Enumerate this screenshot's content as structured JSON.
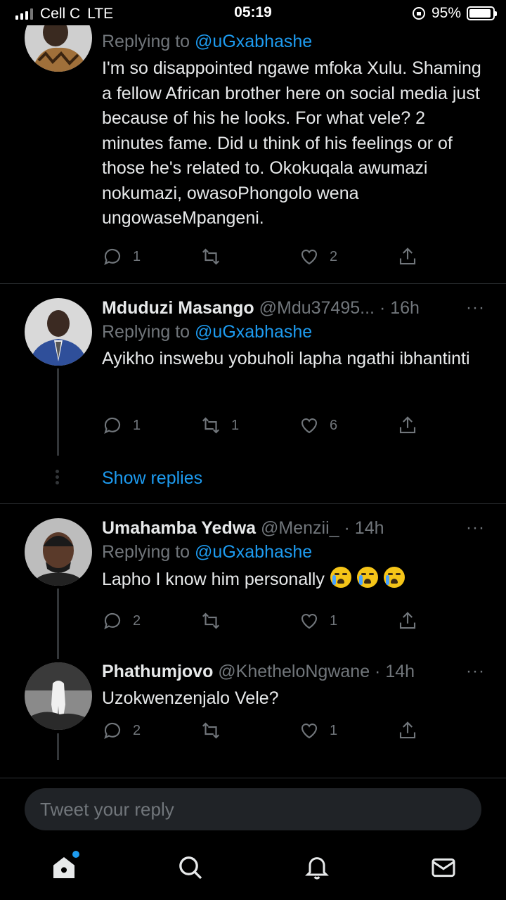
{
  "status_bar": {
    "carrier": "Cell C",
    "network": "LTE",
    "time": "05:19",
    "battery_percent": "95%",
    "battery_level": 0.95
  },
  "replies": [
    {
      "reply_prefix": "Replying to",
      "reply_mention": "@uGxabhashe",
      "text": "I'm so disappointed ngawe mfoka Xulu. Shaming a fellow African brother here on social media just because of his he looks. For what vele? 2 minutes fame. Did u think of his feelings or of those he's related to. Okokuqala awumazi nokumazi, owasoPhongolo wena ungowaseMpangeni.",
      "stats": {
        "replies": "1",
        "retweets": "",
        "likes": "2"
      }
    },
    {
      "name": "Mduduzi Masango",
      "handle": "@Mdu37495...",
      "time": "· 16h",
      "reply_prefix": "Replying to",
      "reply_mention": "@uGxabhashe",
      "text": "Ayikho inswebu yobuholi lapha ngathi ibhantinti",
      "stats": {
        "replies": "1",
        "retweets": "1",
        "likes": "6"
      },
      "show_replies": "Show replies"
    },
    {
      "name": "Umahamba Yedwa",
      "handle": "@Menzii_",
      "time": "· 14h",
      "reply_prefix": "Replying to",
      "reply_mention": "@uGxabhashe",
      "text": "Lapho I know him personally",
      "stats": {
        "replies": "2",
        "retweets": "",
        "likes": "1"
      }
    },
    {
      "name": "Phathumjovo",
      "handle": "@KhetheloNgwane",
      "time": "· 14h",
      "text": "Uzokwenzenjalo Vele?",
      "stats": {
        "replies": "2",
        "retweets": "",
        "likes": "1"
      }
    }
  ],
  "more_icon": "···",
  "reply_bar": {
    "placeholder": "Tweet your reply"
  },
  "tabbar": {
    "icons": [
      "home-icon",
      "search-icon",
      "notifications-icon",
      "messages-icon"
    ]
  },
  "colors": {
    "background": "#000000",
    "accent": "#1d9bf0",
    "muted": "#71767b",
    "text": "#e7e9ea"
  }
}
